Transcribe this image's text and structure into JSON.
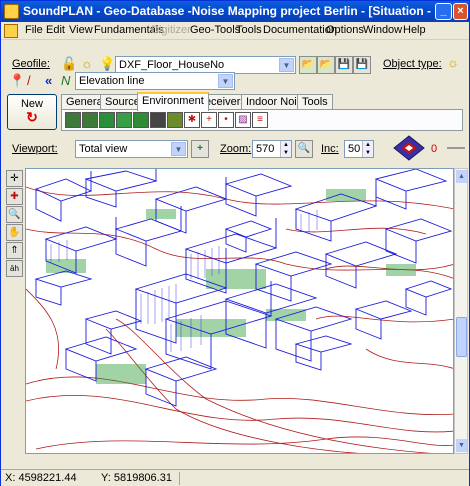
{
  "window": {
    "title": "SoundPLAN - Geo-Database -Noise Mapping project Berlin - [Situation -Basic ..."
  },
  "menu": [
    "File",
    "Edit",
    "View",
    "Fundamentals",
    "Digitizer",
    "Geo-Tools",
    "Tools",
    "Documentation",
    "Options",
    "Window",
    "Help"
  ],
  "menu_disabled": [
    "Digitizer"
  ],
  "geofile": {
    "label": "Geofile:",
    "value": "DXF_Floor_HouseNo",
    "object_type_label": "Object type:"
  },
  "element": {
    "value": "Elevation line"
  },
  "new_button": {
    "label": "New"
  },
  "tabs": [
    "General",
    "Source",
    "Environment",
    "Receivers",
    "Indoor Noise",
    "Tools"
  ],
  "active_tab": "Environment",
  "viewport": {
    "label": "Viewport:",
    "value": "Total view",
    "zoom_label": "Zoom:",
    "zoom_value": "570",
    "inc_label": "Inc:",
    "inc_value": "50",
    "rotation_value": "0"
  },
  "status": {
    "x": "X:  4598221.44",
    "y": "Y:  5819806.31"
  },
  "colors": {
    "titlebar": "#0448c8",
    "buildings": "#1a1adc",
    "elevation_lines": "#b01c1c",
    "green_fill": "#2f9e3b"
  }
}
